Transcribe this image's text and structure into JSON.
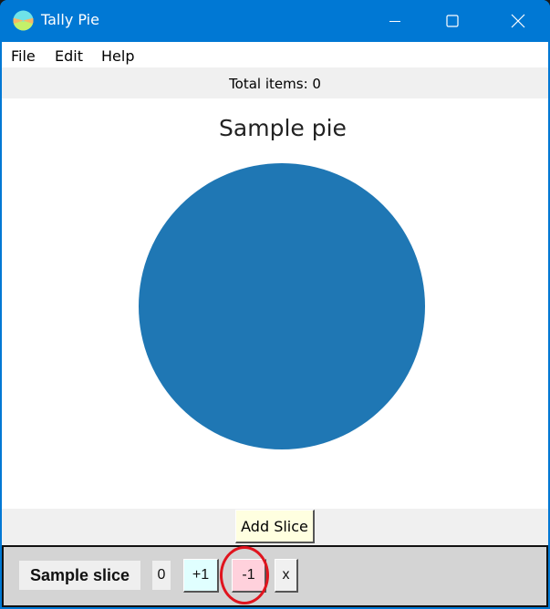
{
  "window": {
    "title": "Tally Pie",
    "icon": "tally-pie-app-icon",
    "controls": [
      "minimize-icon",
      "maximize-icon",
      "close-icon"
    ]
  },
  "menubar": {
    "items": [
      {
        "label": "File"
      },
      {
        "label": "Edit"
      },
      {
        "label": "Help"
      }
    ]
  },
  "status": {
    "total_label": "Total items: 0"
  },
  "chart_data": {
    "type": "pie",
    "title": "Sample pie",
    "slices": [
      {
        "label": "Sample slice",
        "value": 0,
        "color": "#1f77b4"
      }
    ],
    "note": "All slice values are 0; single slice renders as a full circle",
    "legend": "none"
  },
  "controls": {
    "add_slice_label": "Add Slice"
  },
  "slice_rows": [
    {
      "name": "Sample slice",
      "count": "0",
      "increment_label": "+1",
      "decrement_label": "-1",
      "remove_label": "x"
    }
  ],
  "colors": {
    "titlebar": "#0078d4",
    "pie_slice": "#1f77b4",
    "increment_button": "#e0ffff",
    "decrement_button": "#ffd1dc",
    "add_slice_button": "#ffffe0",
    "highlight_ring": "#e0141e"
  },
  "annotation": {
    "highlighted_element": "decrement-button"
  }
}
